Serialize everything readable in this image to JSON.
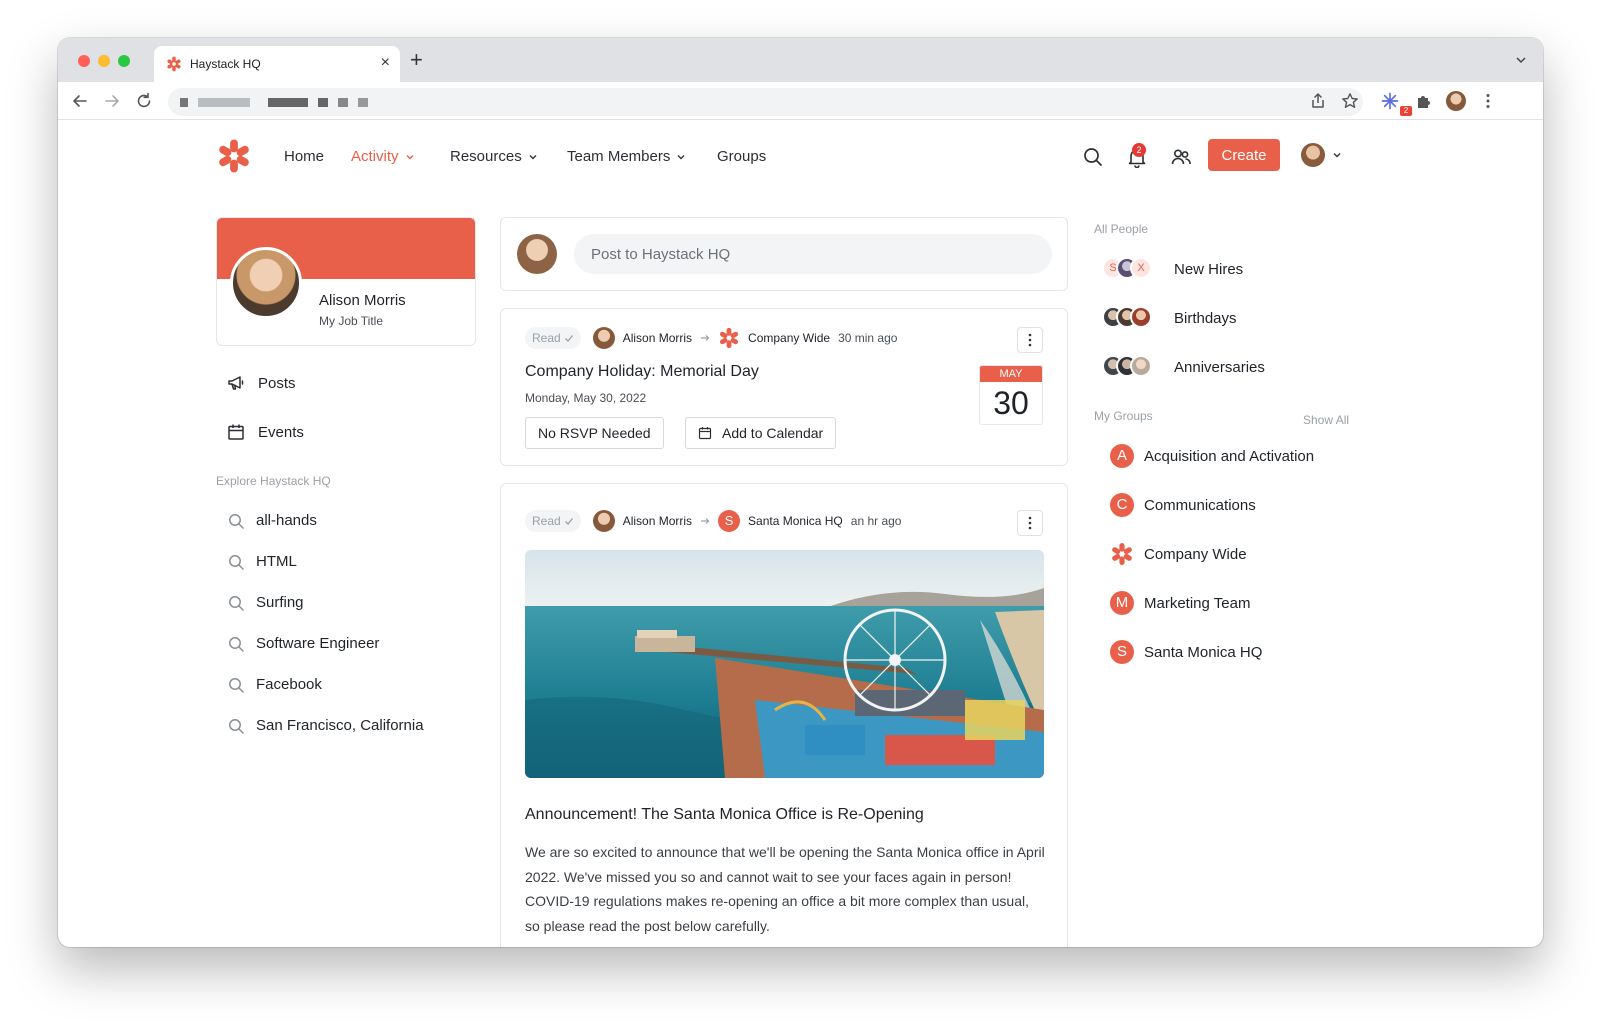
{
  "browser": {
    "tab_title": "Haystack HQ",
    "close_glyph": "×",
    "new_tab_glyph": "+",
    "extension_badge": "2"
  },
  "colors": {
    "brand": "#e8604a"
  },
  "header": {
    "nav": [
      "Home",
      "Activity",
      "Resources",
      "Team Members",
      "Groups"
    ],
    "notification_count": "2",
    "create_label": "Create"
  },
  "profile": {
    "name": "Alison Morris",
    "job_title": "My Job Title"
  },
  "left_nav": {
    "links": [
      "Posts",
      "Events"
    ],
    "explore_label": "Explore Haystack HQ",
    "explore": [
      "all-hands",
      "HTML",
      "Surfing",
      "Software Engineer",
      "Facebook",
      "San Francisco, California"
    ]
  },
  "composer": {
    "placeholder": "Post to Haystack HQ"
  },
  "posts": [
    {
      "read": "Read",
      "author": "Alison Morris",
      "group": "Company Wide",
      "time": "30 min ago",
      "title": "Company Holiday: Memorial Day",
      "date": "Monday, May 30, 2022",
      "rsvp": "No RSVP Needed",
      "calendar": "Add to Calendar",
      "tile_month": "MAY",
      "tile_day": "30"
    },
    {
      "read": "Read",
      "author": "Alison Morris",
      "group_initial": "S",
      "group": "Santa Monica HQ",
      "time": "an hr ago",
      "title": "Announcement! The Santa Monica Office is Re-Opening",
      "body": "We are so excited to announce that we'll be opening the Santa Monica office in April 2022. We've missed you so and cannot wait to see your faces again in person! COVID-19 regulations makes re-opening an office a bit more complex than usual, so please read the post below carefully."
    }
  ],
  "right": {
    "all_people_label": "All People",
    "people": [
      "New Hires",
      "Birthdays",
      "Anniversaries"
    ],
    "new_hires_initials": [
      "S",
      "X"
    ],
    "my_groups_label": "My Groups",
    "show_all": "Show All",
    "groups": [
      {
        "initial": "A",
        "name": "Acquisition and Activation"
      },
      {
        "initial": "C",
        "name": "Communications"
      },
      {
        "initial": "",
        "name": "Company Wide"
      },
      {
        "initial": "M",
        "name": "Marketing Team"
      },
      {
        "initial": "S",
        "name": "Santa Monica HQ"
      }
    ]
  }
}
